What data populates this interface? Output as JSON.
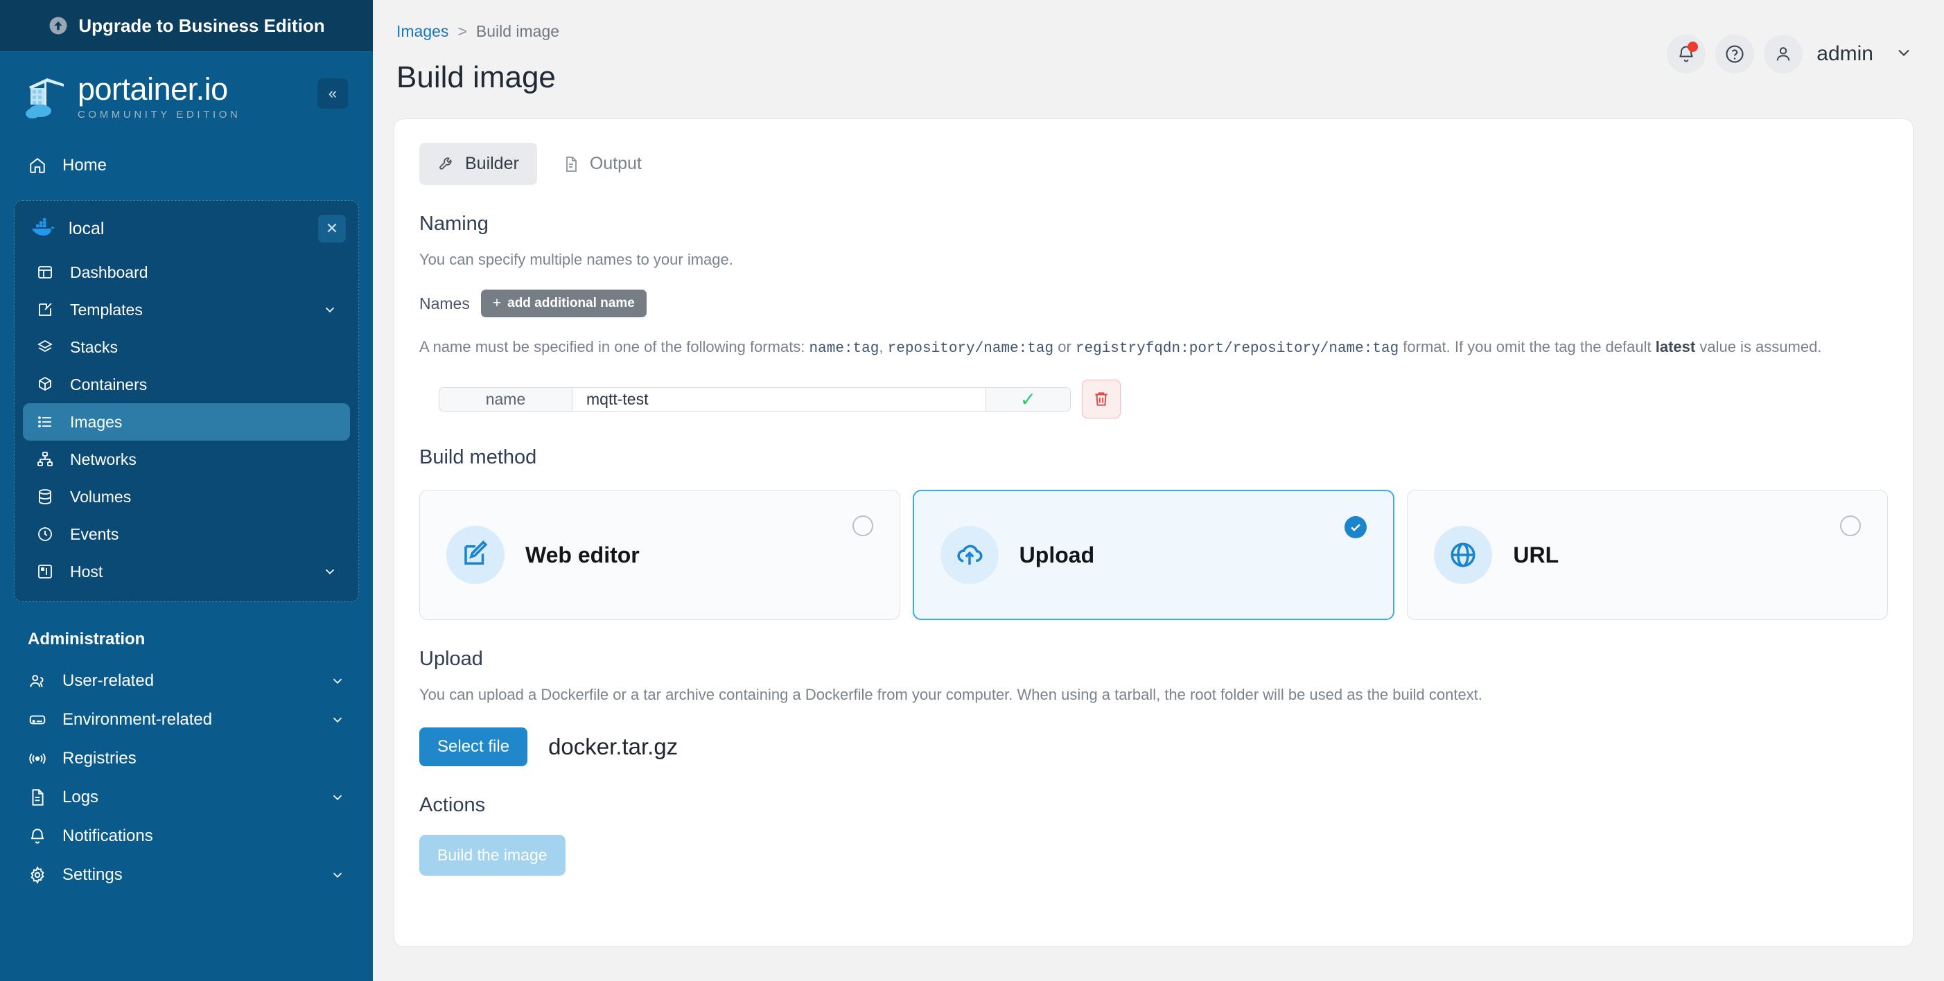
{
  "sidebar": {
    "upgrade_banner": "Upgrade to Business Edition",
    "upgrade_icon": "up-circle-icon",
    "logo_title": "portainer.io",
    "logo_subtitle": "COMMUNITY EDITION",
    "collapse_icon": "chevron-double-left-icon",
    "home": {
      "label": "Home",
      "icon": "home-icon"
    },
    "environment": {
      "name": "local",
      "icon": "docker-whale-icon",
      "close_icon": "close-icon",
      "items": [
        {
          "label": "Dashboard",
          "icon": "dashboard-icon",
          "expandable": false,
          "active": false
        },
        {
          "label": "Templates",
          "icon": "template-edit-icon",
          "expandable": true,
          "active": false
        },
        {
          "label": "Stacks",
          "icon": "stacks-layers-icon",
          "expandable": false,
          "active": false
        },
        {
          "label": "Containers",
          "icon": "container-box-icon",
          "expandable": false,
          "active": false
        },
        {
          "label": "Images",
          "icon": "images-list-icon",
          "expandable": false,
          "active": true
        },
        {
          "label": "Networks",
          "icon": "networks-icon",
          "expandable": false,
          "active": false
        },
        {
          "label": "Volumes",
          "icon": "volumes-database-icon",
          "expandable": false,
          "active": false
        },
        {
          "label": "Events",
          "icon": "events-clock-icon",
          "expandable": false,
          "active": false
        },
        {
          "label": "Host",
          "icon": "host-server-icon",
          "expandable": true,
          "active": false
        }
      ]
    },
    "administration_title": "Administration",
    "admin_items": [
      {
        "label": "User-related",
        "icon": "users-icon",
        "expandable": true
      },
      {
        "label": "Environment-related",
        "icon": "environment-server-icon",
        "expandable": true
      },
      {
        "label": "Registries",
        "icon": "registries-broadcast-icon",
        "expandable": false
      },
      {
        "label": "Logs",
        "icon": "logs-document-icon",
        "expandable": true
      },
      {
        "label": "Notifications",
        "icon": "bell-icon",
        "expandable": false
      },
      {
        "label": "Settings",
        "icon": "gear-icon",
        "expandable": true
      }
    ]
  },
  "header": {
    "breadcrumb": {
      "parent": "Images",
      "separator": ">",
      "current": "Build image"
    },
    "page_title": "Build image",
    "notifications_icon": "bell-icon",
    "help_icon": "question-circle-icon",
    "avatar_icon": "user-icon",
    "user_name": "admin",
    "user_chevron_icon": "chevron-down-icon"
  },
  "tabs": [
    {
      "label": "Builder",
      "icon": "wrench-icon",
      "active": true
    },
    {
      "label": "Output",
      "icon": "document-icon",
      "active": false
    }
  ],
  "naming": {
    "title": "Naming",
    "description": "You can specify multiple names to your image.",
    "names_label": "Names",
    "add_button": "add additional name",
    "hint_prefix": "A name must be specified in one of the following formats:",
    "code_1": "name:tag",
    "hint_comma": ",",
    "code_2": "repository/name:tag",
    "hint_or": "or",
    "code_3": "registryfqdn:port/repository/name:tag",
    "hint_mid": "format. If you omit the tag the default",
    "hint_bold": "latest",
    "hint_suffix": "value is assumed.",
    "row": {
      "prefix_label": "name",
      "value": "mqtt-test",
      "placeholder": "",
      "confirm_icon": "check-icon",
      "delete_icon": "trash-icon"
    }
  },
  "build_method": {
    "title": "Build method",
    "options": [
      {
        "label": "Web editor",
        "icon": "edit-pencil-icon",
        "selected": false
      },
      {
        "label": "Upload",
        "icon": "cloud-upload-icon",
        "selected": true
      },
      {
        "label": "URL",
        "icon": "globe-icon",
        "selected": false
      }
    ]
  },
  "upload": {
    "title": "Upload",
    "description": "You can upload a Dockerfile or a tar archive containing a Dockerfile from your computer. When using a tarball, the root folder will be used as the build context.",
    "select_file_label": "Select file",
    "file_name": "docker.tar.gz"
  },
  "actions": {
    "title": "Actions",
    "build_label": "Build the image"
  },
  "colors": {
    "sidebar_bg": "#0a5b8c",
    "banner_bg": "#0b3d5e",
    "accent_blue": "#2087cb",
    "selected_card_border": "#3aaaf0",
    "danger_red": "#ef3b2d",
    "success_green": "#2ecc71"
  }
}
